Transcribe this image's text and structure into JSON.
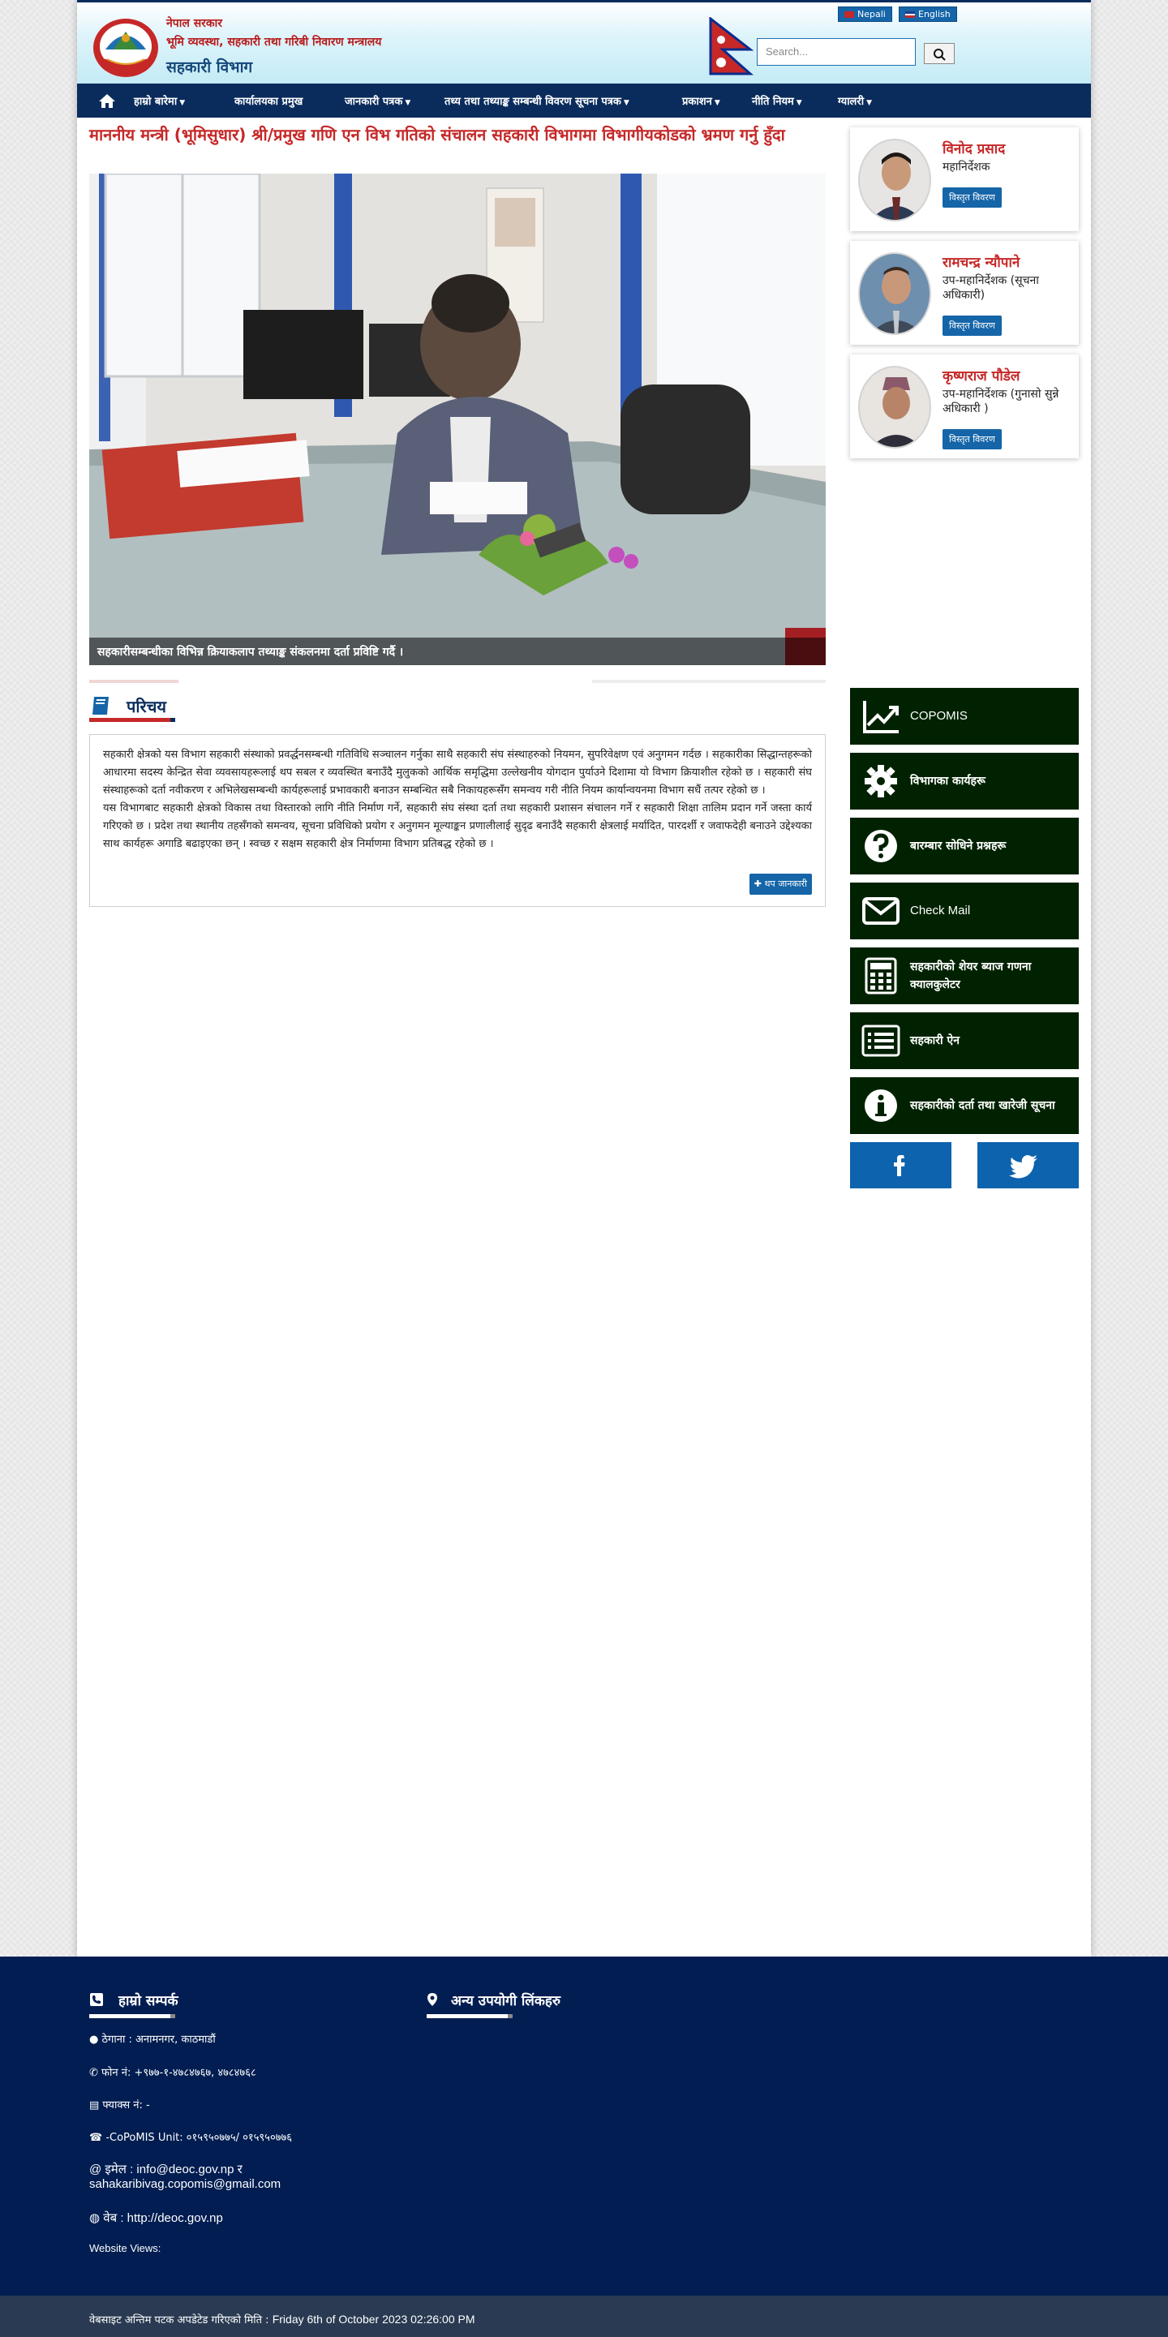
{
  "header": {
    "ministry_line1": "नेपाल सरकार",
    "ministry_line2": "भूमि व्यवस्था, सहकारी तथा गरिबी निवारण मन्त्रालय",
    "office_name": "सहकारी विभाग",
    "lang_nepali": "Nepali",
    "lang_english": "English",
    "search_placeholder": "Search..."
  },
  "nav": {
    "items": [
      {
        "label": "हाम्रो बारेमा",
        "dropdown": true
      },
      {
        "label": "कार्यालयका प्रमुख",
        "dropdown": false
      },
      {
        "label": "जानकारी पत्रक",
        "dropdown": true
      },
      {
        "label": "तथ्य तथा तथ्याङ्क सम्बन्धी विवरण सूचना पत्रक",
        "dropdown": true
      },
      {
        "label": "प्रकाशन",
        "dropdown": true
      },
      {
        "label": "नीति नियम",
        "dropdown": true
      },
      {
        "label": "ग्यालरी",
        "dropdown": true
      }
    ]
  },
  "main": {
    "headline": "माननीय मन्त्री (भूमिसुधार) श्री/प्रमुख गणि एन विभ गतिको संचालन सहकारी विभागमा विभागीयकोडको भ्रमण गर्नु हुँदा",
    "hero_caption": "सहकारीसम्बन्धीका विभिन्न क्रियाकलाप तथ्याङ्क संकलनमा दर्ता प्रविष्टि गर्दै ।",
    "section_title": "परिचय",
    "intro_text": "सहकारी क्षेत्रको यस विभाग सहकारी संस्थाको प्रवर्द्धनसम्बन्धी गतिविधि सञ्चालन गर्नुका साथै सहकारी संघ संस्थाहरुको नियमन, सुपरिवेक्षण एवं अनुगमन गर्दछ । सहकारीका सिद्धान्तहरूको आधारमा सदस्य केन्द्रित सेवा व्यवसायहरूलाई थप सबल र व्यवस्थित बनाउँदै मुलुकको आर्थिक समृद्धिमा उल्लेखनीय योगदान पुर्याउने दिशामा यो विभाग क्रियाशील रहेको छ । सहकारी संघ संस्थाहरूको दर्ता नवीकरण र अभिलेखसम्बन्धी कार्यहरूलाई प्रभावकारी बनाउन सम्बन्धित सबै निकायहरूसँग समन्वय गरी नीति नियम कार्यान्वयनमा विभाग सधैं तत्पर रहेको छ ।\nयस विभागबाट सहकारी क्षेत्रको विकास तथा विस्तारको लागि नीति निर्माण गर्ने, सहकारी संघ संस्था दर्ता तथा सहकारी प्रशासन संचालन गर्ने र सहकारी शिक्षा तालिम प्रदान गर्ने जस्ता कार्य गरिएको छ । प्रदेश तथा स्थानीय तहसँगको समन्वय, सूचना प्रविधिको प्रयोग र अनुगमन मूल्याङ्कन प्रणालीलाई सुदृढ बनाउँदै सहकारी क्षेत्रलाई मर्यादित, पारदर्शी र जवाफदेही बनाउने उद्देश्यका साथ कार्यहरू अगाडि बढाइएका छन् । स्वच्छ र सक्षम सहकारी क्षेत्र निर्माणमा विभाग प्रतिबद्ध रहेको छ ।",
    "more_label": "थप जानकारी"
  },
  "people": [
    {
      "name": "विनोद प्रसाद",
      "designation": "महानिर्देशक",
      "button": "विस्तृत विवरण"
    },
    {
      "name": "रामचन्द्र न्यौपाने",
      "designation": "उप-महानिर्देशक (सूचना अधिकारी)",
      "button": "विस्तृत विवरण"
    },
    {
      "name": "कृष्णराज पौडेल",
      "designation": "उप-महानिर्देशक (गुनासो सुन्ने अधिकारी )",
      "button": "विस्तृत विवरण"
    }
  ],
  "quick_links": [
    {
      "label": "COPOMIS",
      "icon": "chart-line-icon",
      "latin": true
    },
    {
      "label": "विभागका कार्यहरू",
      "icon": "gear-icon",
      "latin": false
    },
    {
      "label": "बारम्बार सोधिने प्रश्नहरू",
      "icon": "question-icon",
      "latin": false
    },
    {
      "label": "Check Mail",
      "icon": "envelope-icon",
      "latin": true
    },
    {
      "label": "सहकारीको शेयर ब्याज गणना क्यालकुलेटर",
      "icon": "calculator-icon",
      "latin": false
    },
    {
      "label": "सहकारी ऐन",
      "icon": "list-icon",
      "latin": false
    },
    {
      "label": "सहकारीको दर्ता तथा खारेजी सूचना",
      "icon": "info-icon",
      "latin": false
    }
  ],
  "social": {
    "facebook": "facebook-icon",
    "twitter": "twitter-icon"
  },
  "footer": {
    "contact_title": "हाम्रो सम्पर्क",
    "links_title": "अन्य उपयोगी लिंकहरु",
    "address": "ठेगाना : अनामनगर, काठमाडौं",
    "phone": "फोन नं: +९७७-१-४७८४७६७, ४७८४७६८",
    "fax": "फ्याक्स नं: -",
    "copomis_unit": "-CoPoMIS Unit: ०१५९५०७७५/ ०१५९५०७७६",
    "email": "@ इमेल : info@deoc.gov.np र",
    "email2": "sahakaribivag.copomis@gmail.com",
    "web": "वेब : http://deoc.gov.np",
    "views": "Website Views:",
    "updated_prefix": "वेबसाइट अन्तिम पटक अपडेटेड गरिएको मिति :",
    "updated_date": "Friday 6th of October 2023 02:26:00 PM"
  },
  "colors": {
    "navy": "#0a2c5c",
    "red": "#c62828",
    "quicklink_green": "#002200",
    "footer_navy": "#011d51",
    "button_blue": "#1565a8"
  }
}
